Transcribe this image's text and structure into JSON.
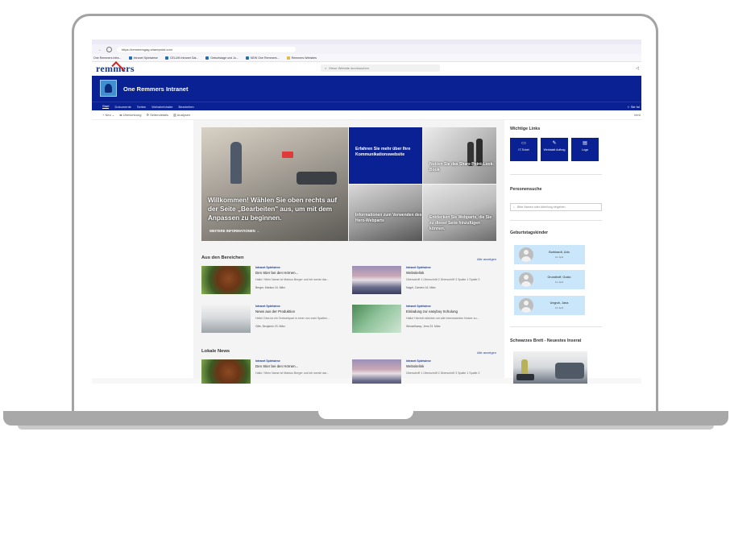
{
  "browser": {
    "url": "https://remmersgag.sharepoint.com",
    "bookmarks": [
      "One Remmers Infra...",
      "Intranet Spielwiese",
      "CELUM Intranet Gal...",
      "Geburtstage und Ju...",
      "NEW One Remmers...",
      "Remmers Websites"
    ]
  },
  "sharepoint": {
    "brand": "remmers",
    "search_placeholder": "Diese Website durchsuchen"
  },
  "site": {
    "title": "One Remmers Intranet",
    "nav": [
      "Start",
      "Dokumente",
      "Seiten",
      "Websiteinhalte",
      "Bearbeiten"
    ],
    "follow": "Sie fol",
    "commands": {
      "new": "Neu",
      "translate": "Übersetzung",
      "details": "Seitendetails",
      "analytics": "Analysen",
      "right": "Verö"
    }
  },
  "hero": {
    "main_text": "Willkommen! Wählen Sie oben rechts auf der Seite „Bearbeiten\" aus, um mit dem Anpassen zu beginnen.",
    "main_link": "WEITERE INFORMATIONEN →",
    "tile_blue": "Erfahren Sie mehr über Ihre Kommunikationswebsite",
    "tile_r1": "Nutzen Sie das Share Point-Look-Book",
    "tile_b1": "Informationen zum Verwenden des Hero-Webparts",
    "tile_b2": "Entdecken Sie Webparts, die Sie zu dieser Seite hinzufügen können."
  },
  "news_sections": [
    {
      "title": "Aus den Bereichen",
      "more": "Alle anzeigen",
      "items": [
        {
          "category": "Intranet Spielwiese",
          "title": "Den Stier bei den Hörnen...",
          "desc": "Hallo ! Mein Name ist Markus Berger und ich werde dar...",
          "author": "Berger, Markus 16. März"
        },
        {
          "category": "Intranet Spielwiese",
          "title": "Websitelink",
          "desc": "Überschrift 1 Überschrift 2 Überschrift 3 Spalte 1 Spalte 2",
          "author": "Nagel, Carsten 16. März"
        },
        {
          "category": "Intranet Spielwiese",
          "title": "News aus der Produktion",
          "desc": "Hello! Dies ist ein Textwebpart in einer von zwei Spalten...",
          "author": "Gille, Benjamin 23. März"
        },
        {
          "category": "Intranet Spielwiese",
          "title": "Einladung zur easyboy Schulung",
          "desc": "Hallo! Hiermit möchten wir alle interessierten Nutzer zu...",
          "author": "Wesselkamp, Jens 23. März"
        }
      ]
    },
    {
      "title": "Lokale News",
      "more": "Alle anzeigen",
      "items": [
        {
          "category": "Intranet Spielwiese",
          "title": "Den Stier bei den Hörnen...",
          "desc": "Hallo ! Mein Name ist Markus Berger und ich werde dar..."
        },
        {
          "category": "Intranet Spielwiese",
          "title": "Websitelink",
          "desc": "Überschrift 1 Überschrift 2 Überschrift 3 Spalte 1 Spalte 2"
        }
      ]
    }
  ],
  "sidebar": {
    "links_title": "Wichtige Links",
    "links": [
      {
        "label": "IT-Ticket",
        "icon": "monitor-icon"
      },
      {
        "label": "Werkstatt Auftrag",
        "icon": "edit-icon"
      },
      {
        "label": "Loga",
        "icon": "document-icon"
      }
    ],
    "people_title": "Personensuche",
    "people_placeholder": "Bitte Namen oder Abteilung eingeben",
    "birthday_title": "Geburtstagskinder",
    "birthdays": [
      {
        "name": "Burkhardt, Udo",
        "date": "14. April"
      },
      {
        "name": "Grundhoff, Guido",
        "date": "14. April"
      },
      {
        "name": "Ungruh, Jana",
        "date": "14. April"
      }
    ],
    "board_title": "Schwarzes Brett - Neuestes Inserat"
  }
}
